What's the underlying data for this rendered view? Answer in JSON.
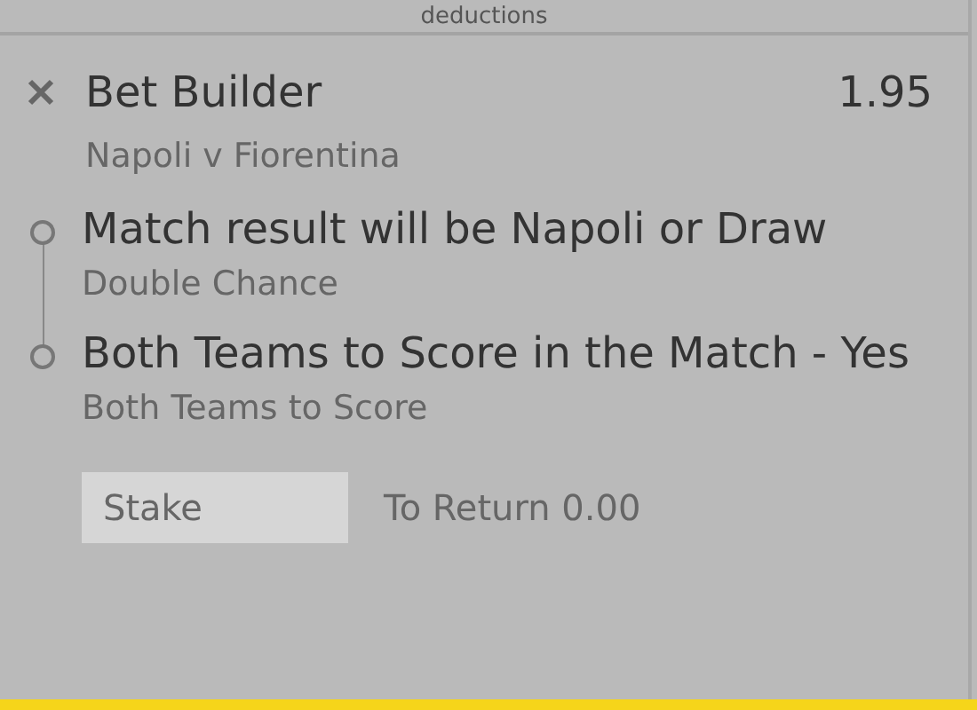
{
  "header": {
    "title": "deductions"
  },
  "bet": {
    "title": "Bet Builder",
    "odds": "1.95",
    "event": "Napoli v Fiorentina",
    "selections": [
      {
        "name": "Match result will be Napoli or Draw",
        "market": "Double Chance"
      },
      {
        "name": "Both Teams to Score in the Match - Yes",
        "market": "Both Teams to Score"
      }
    ],
    "stake": {
      "placeholder": "Stake"
    },
    "to_return": "To Return 0.00"
  }
}
